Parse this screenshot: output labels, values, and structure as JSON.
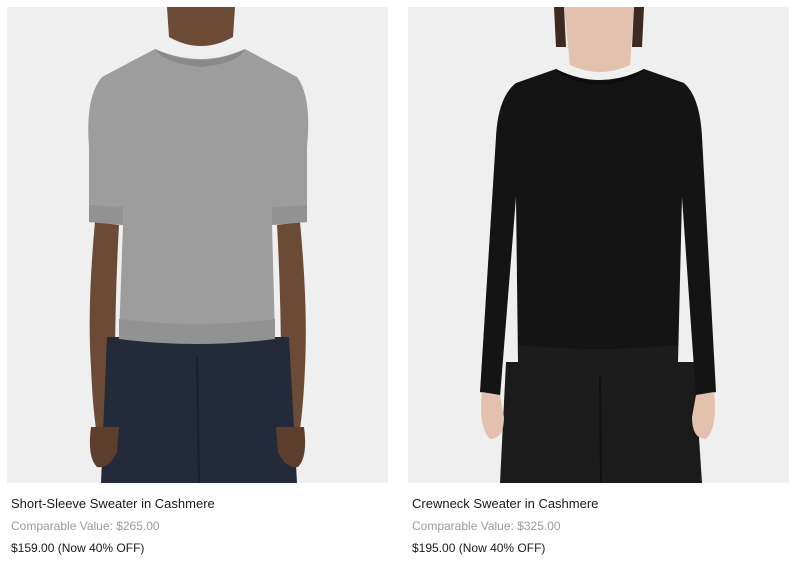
{
  "products": [
    {
      "title": "Short-Sleeve Sweater in Cashmere",
      "comparable_label": "Comparable Value:",
      "comparable_value": "$265.00",
      "price": "$159.00",
      "discount": "(Now 40% OFF)",
      "image_alt": "Model wearing grey short-sleeve cashmere sweater with navy trousers",
      "sweater_color": "#9d9d9d",
      "pants_color": "#232a3a",
      "skin_color": "#6b4a36"
    },
    {
      "title": "Crewneck Sweater in Cashmere",
      "comparable_label": "Comparable Value:",
      "comparable_value": "$325.00",
      "price": "$195.00",
      "discount": "(Now 40% OFF)",
      "image_alt": "Model wearing black crewneck cashmere sweater with black trousers",
      "sweater_color": "#141414",
      "pants_color": "#1b1b1b",
      "skin_color": "#e2c2ae"
    }
  ],
  "colors": {
    "image_background": "#efefef",
    "muted_text": "#9a9a9a",
    "text": "#1a1a1a"
  }
}
